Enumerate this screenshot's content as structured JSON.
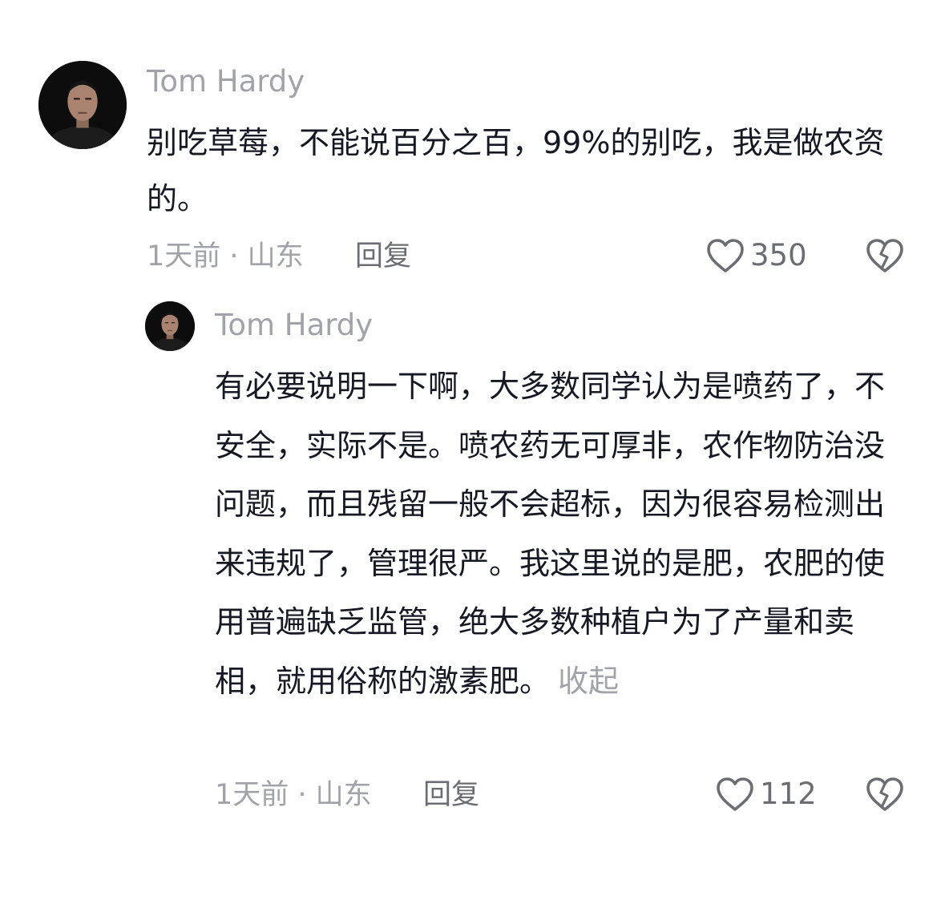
{
  "comments": [
    {
      "username": "Tom Hardy",
      "text": "别吃草莓，不能说百分之百，99%的别吃，我是做农资的。",
      "time_location": "1天前 · 山东",
      "reply_label": "回复",
      "likes": "350",
      "icons": {
        "like": "heart-outline-icon",
        "dislike": "broken-heart-icon"
      }
    },
    {
      "username": "Tom Hardy",
      "text": "有必要说明一下啊，大多数同学认为是喷药了，不安全，实际不是。喷农药无可厚非，农作物防治没问题，而且残留一般不会超标，因为很容易检测出来违规了，管理很严。我这里说的是肥，农肥的使用普遍缺乏监管，绝大多数种植户为了产量和卖相，就用俗称的激素肥。",
      "collapse_label": "收起",
      "time_location": "1天前 · 山东",
      "reply_label": "回复",
      "likes": "112",
      "icons": {
        "like": "heart-outline-icon",
        "dislike": "broken-heart-icon"
      }
    }
  ],
  "colors": {
    "text": "#161823",
    "secondary": "#a1a3a8",
    "action": "#6b6d73",
    "background": "#ffffff"
  }
}
